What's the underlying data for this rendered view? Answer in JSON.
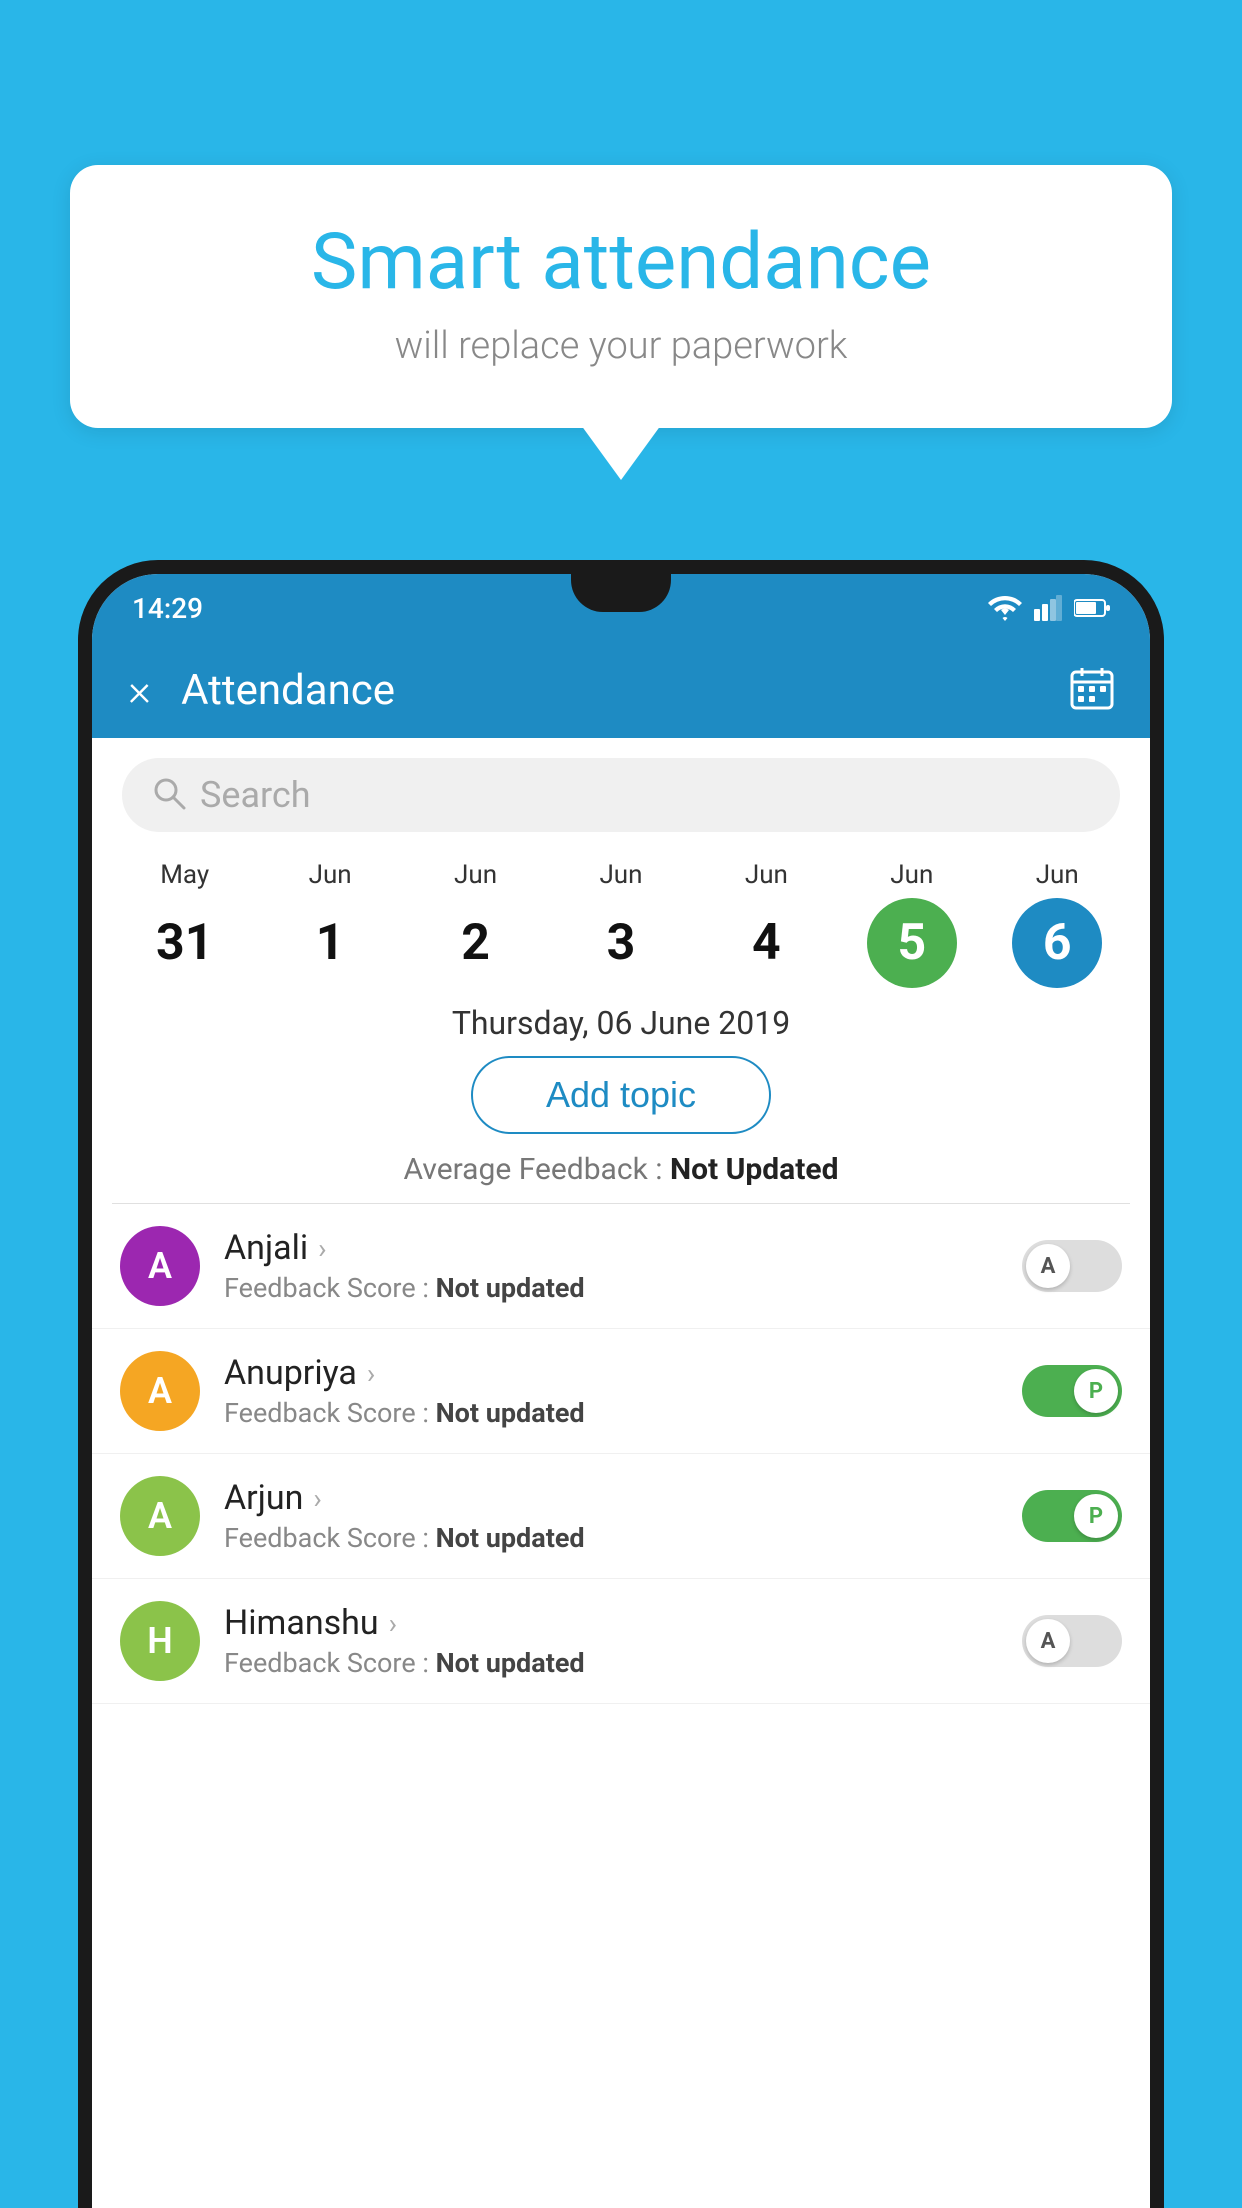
{
  "background_color": "#29b6e8",
  "bubble": {
    "title": "Smart attendance",
    "subtitle": "will replace your paperwork"
  },
  "status_bar": {
    "time": "14:29",
    "icons": [
      "wifi",
      "signal",
      "battery"
    ]
  },
  "header": {
    "title": "Attendance",
    "close_label": "×",
    "calendar_icon": "calendar-icon"
  },
  "search": {
    "placeholder": "Search"
  },
  "calendar": {
    "days": [
      {
        "month": "May",
        "day": "31",
        "state": "normal"
      },
      {
        "month": "Jun",
        "day": "1",
        "state": "normal"
      },
      {
        "month": "Jun",
        "day": "2",
        "state": "normal"
      },
      {
        "month": "Jun",
        "day": "3",
        "state": "normal"
      },
      {
        "month": "Jun",
        "day": "4",
        "state": "normal"
      },
      {
        "month": "Jun",
        "day": "5",
        "state": "today"
      },
      {
        "month": "Jun",
        "day": "6",
        "state": "selected"
      }
    ]
  },
  "selected_date_label": "Thursday, 06 June 2019",
  "add_topic_label": "Add topic",
  "avg_feedback_label": "Average Feedback : ",
  "avg_feedback_value": "Not Updated",
  "students": [
    {
      "name": "Anjali",
      "avatar_letter": "A",
      "avatar_color": "#9c27b0",
      "feedback_label": "Feedback Score : ",
      "feedback_value": "Not updated",
      "toggle_state": "off",
      "toggle_label": "A"
    },
    {
      "name": "Anupriya",
      "avatar_letter": "A",
      "avatar_color": "#f5a623",
      "feedback_label": "Feedback Score : ",
      "feedback_value": "Not updated",
      "toggle_state": "on",
      "toggle_label": "P"
    },
    {
      "name": "Arjun",
      "avatar_letter": "A",
      "avatar_color": "#8bc34a",
      "feedback_label": "Feedback Score : ",
      "feedback_value": "Not updated",
      "toggle_state": "on",
      "toggle_label": "P"
    },
    {
      "name": "Himanshu",
      "avatar_letter": "H",
      "avatar_color": "#8bc34a",
      "feedback_label": "Feedback Score : ",
      "feedback_value": "Not updated",
      "toggle_state": "off",
      "toggle_label": "A"
    }
  ]
}
